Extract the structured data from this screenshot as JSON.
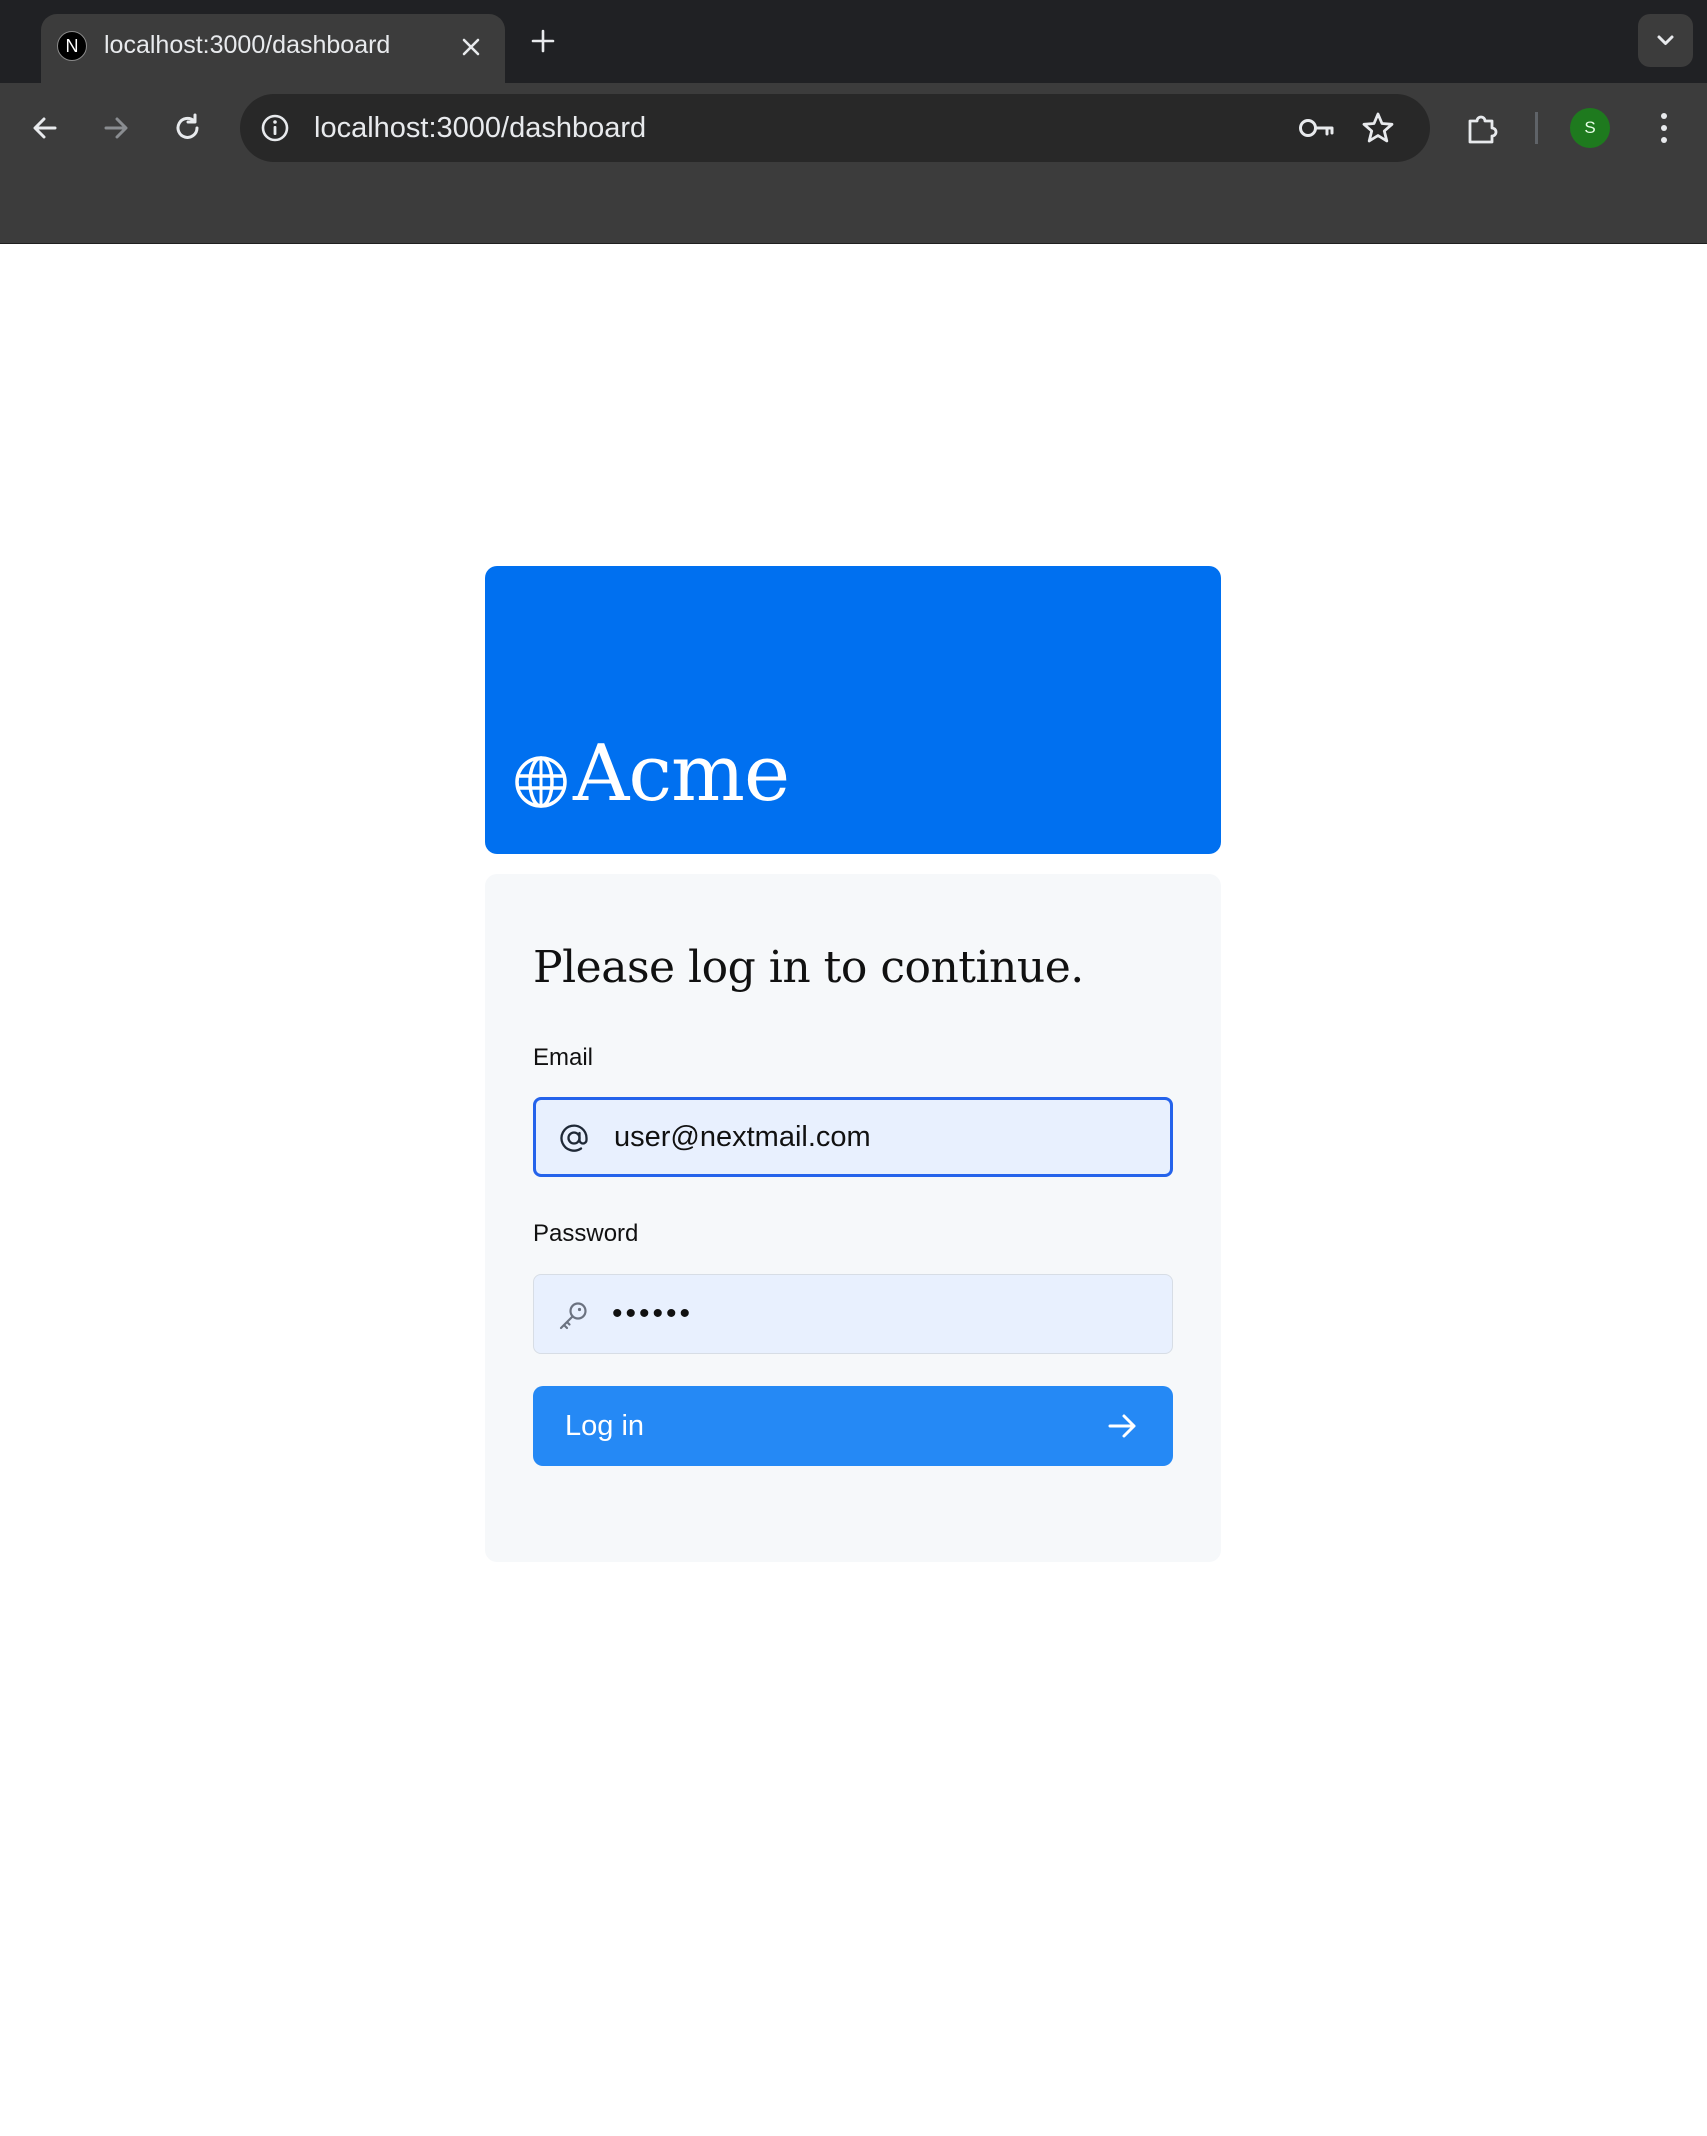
{
  "browser": {
    "tab": {
      "favicon_letter": "N",
      "title": "localhost:3000/dashboard"
    },
    "address_bar": {
      "url": "localhost:3000/dashboard"
    },
    "profile": {
      "avatar_letter": "S",
      "avatar_color": "#1e7a1e"
    },
    "icons": {
      "back": "back-arrow-icon",
      "forward": "forward-arrow-icon",
      "reload": "reload-icon",
      "site_info": "info-icon",
      "password_manager": "key-icon",
      "bookmark": "star-icon",
      "extensions": "puzzle-piece-icon",
      "menu": "kebab-menu-icon",
      "new_tab": "plus-icon",
      "close_tab": "close-icon",
      "tab_search": "chevron-down-icon"
    }
  },
  "brand": {
    "name": "Acme",
    "logo_icon": "globe-icon",
    "color": "#0070f0"
  },
  "login": {
    "heading": "Please log in to continue.",
    "email": {
      "label": "Email",
      "value": "user@nextmail.com",
      "icon": "at-sign-icon"
    },
    "password": {
      "label": "Password",
      "value": "••••••",
      "icon": "key-icon"
    },
    "submit": {
      "label": "Log in",
      "icon": "arrow-right-icon",
      "color": "#2589f5"
    }
  }
}
